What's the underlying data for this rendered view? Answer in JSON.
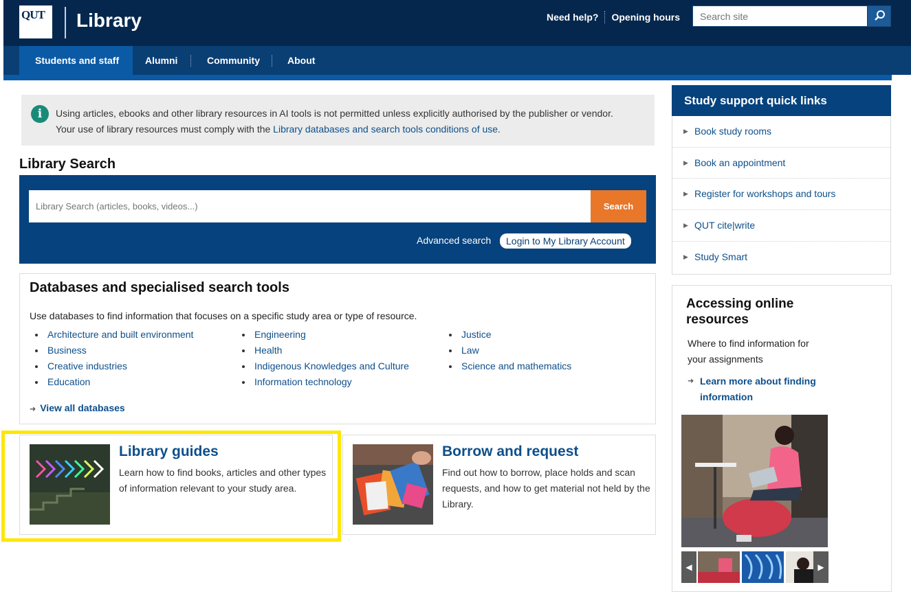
{
  "header": {
    "logo_text": "QUT",
    "site_title": "Library",
    "need_help": "Need help?",
    "opening_hours": "Opening hours",
    "search_placeholder": "Search site"
  },
  "nav": {
    "items": [
      {
        "label": "Students and staff",
        "active": true
      },
      {
        "label": "Alumni",
        "active": false
      },
      {
        "label": "Community",
        "active": false
      },
      {
        "label": "About",
        "active": false
      }
    ]
  },
  "alert": {
    "line1": "Using articles, ebooks and other library resources in AI tools is not permitted unless explicitly authorised by the publisher or vendor.",
    "line2_prefix": "Your use of library resources must comply with the ",
    "line2_link": "Library databases and search tools conditions of use",
    "line2_suffix": "."
  },
  "library_search": {
    "heading": "Library Search",
    "placeholder": "Library Search (articles, books, videos...)",
    "button": "Search",
    "advanced": "Advanced search",
    "login": "Login to My Library Account"
  },
  "databases": {
    "title": "Databases and specialised search tools",
    "description": "Use databases to find information that focuses on a specific study area or type of resource.",
    "col1": [
      "Architecture and built environment",
      "Business",
      "Creative industries",
      "Education"
    ],
    "col2": [
      "Engineering",
      "Health",
      "Indigenous Knowledges and Culture",
      "Information technology"
    ],
    "col3": [
      "Justice",
      "Law",
      "Science and mathematics"
    ],
    "view_all": "View all databases"
  },
  "cards": [
    {
      "title": "Library guides",
      "text": "Learn how to find books, articles and other types of information relevant to your study area."
    },
    {
      "title": "Borrow and request",
      "text": "Find out how to borrow, place holds and scan requests, and how to get material not held by the Library."
    }
  ],
  "quick_links": {
    "heading": "Study support quick links",
    "items": [
      "Book study rooms",
      "Book an appointment",
      "Register for workshops and tours",
      "QUT cite|write",
      "Study Smart"
    ]
  },
  "online_resources": {
    "title": "Accessing online resources",
    "description": "Where to find information for your assignments",
    "link": "Learn more about finding information"
  },
  "colors": {
    "header_bg": "#06274d",
    "nav_bg": "#0a3f74",
    "active_tab": "#0b5aa6",
    "search_button": "#e8772a",
    "link": "#0d4f8b",
    "highlight": "#ffe600"
  }
}
